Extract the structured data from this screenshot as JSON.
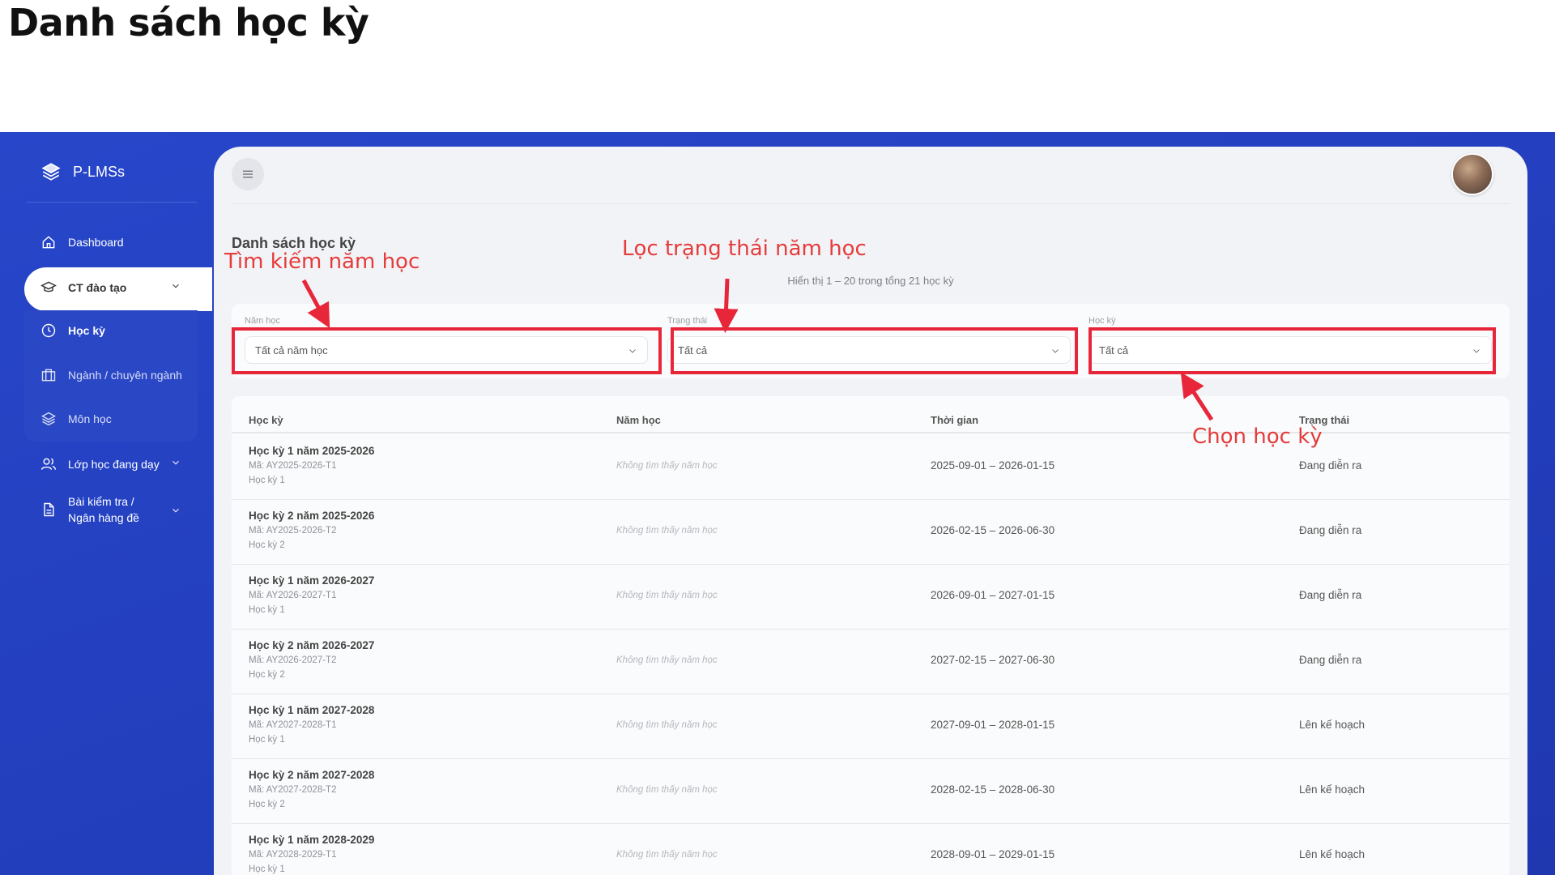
{
  "slide_title": "Danh sách học kỳ",
  "brand": {
    "name": "P-LMSs"
  },
  "sidebar": {
    "dashboard": "Dashboard",
    "ct_dao_tao": "CT đào tạo",
    "sub": [
      "Học kỳ",
      "Ngành / chuyên ngành",
      "Môn học"
    ],
    "lop_hoc": "Lớp học đang dạy",
    "bai_kiem_tra_1": "Bài kiểm tra /",
    "bai_kiem_tra_2": "Ngân hàng đề"
  },
  "page": {
    "title": "Danh sách học kỳ",
    "count": "Hiển thị 1 – 20 trong tổng 21 học kỳ"
  },
  "filters": {
    "year_label": "Năm học",
    "year_value": "Tất cả năm học",
    "status_label": "Trạng thái",
    "status_value": "Tất cả",
    "term_label": "Học kỳ",
    "term_value": "Tất cả"
  },
  "table": {
    "headers": [
      "Học kỳ",
      "Năm học",
      "Thời gian",
      "Trạng thái"
    ],
    "rows": [
      {
        "name": "Học kỳ 1 năm 2025-2026",
        "code": "Mã: AY2025-2026-T1",
        "term": "Học kỳ 1",
        "year": "Không tìm thấy năm học",
        "time": "2025-09-01 – 2026-01-15",
        "status": "Đang diễn ra"
      },
      {
        "name": "Học kỳ 2 năm 2025-2026",
        "code": "Mã: AY2025-2026-T2",
        "term": "Học kỳ 2",
        "year": "Không tìm thấy năm học",
        "time": "2026-02-15 – 2026-06-30",
        "status": "Đang diễn ra"
      },
      {
        "name": "Học kỳ 1 năm 2026-2027",
        "code": "Mã: AY2026-2027-T1",
        "term": "Học kỳ 1",
        "year": "Không tìm thấy năm học",
        "time": "2026-09-01 – 2027-01-15",
        "status": "Đang diễn ra"
      },
      {
        "name": "Học kỳ 2 năm 2026-2027",
        "code": "Mã: AY2026-2027-T2",
        "term": "Học kỳ 2",
        "year": "Không tìm thấy năm học",
        "time": "2027-02-15 – 2027-06-30",
        "status": "Đang diễn ra"
      },
      {
        "name": "Học kỳ 1 năm 2027-2028",
        "code": "Mã: AY2027-2028-T1",
        "term": "Học kỳ 1",
        "year": "Không tìm thấy năm học",
        "time": "2027-09-01 – 2028-01-15",
        "status": "Lên kế hoạch"
      },
      {
        "name": "Học kỳ 2 năm 2027-2028",
        "code": "Mã: AY2027-2028-T2",
        "term": "Học kỳ 2",
        "year": "Không tìm thấy năm học",
        "time": "2028-02-15 – 2028-06-30",
        "status": "Lên kế hoạch"
      },
      {
        "name": "Học kỳ 1 năm 2028-2029",
        "code": "Mã: AY2028-2029-T1",
        "term": "Học kỳ 1",
        "year": "Không tìm thấy năm học",
        "time": "2028-09-01 – 2029-01-15",
        "status": "Lên kế hoạch"
      }
    ]
  },
  "annotations": {
    "search_year": "Tìm kiếm năm học",
    "filter_status": "Lọc trạng thái năm học",
    "choose_term": "Chọn học kỳ",
    "color": "#e8263a"
  }
}
